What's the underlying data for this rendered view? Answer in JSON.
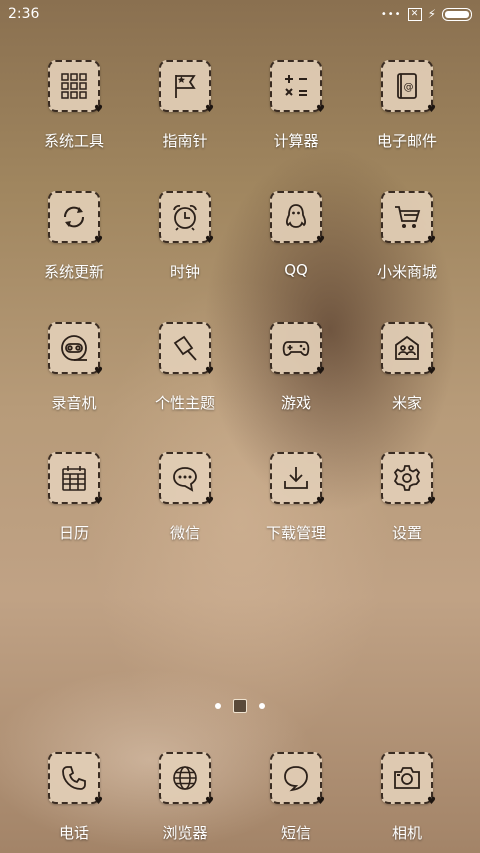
{
  "status_bar": {
    "time": "2:36"
  },
  "apps": [
    {
      "label": "系统工具",
      "icon": "folder-grid-icon",
      "slug": "system-tools"
    },
    {
      "label": "指南针",
      "icon": "compass-flag-icon",
      "slug": "compass"
    },
    {
      "label": "计算器",
      "icon": "calculator-icon",
      "slug": "calculator"
    },
    {
      "label": "电子邮件",
      "icon": "mail-icon",
      "slug": "email"
    },
    {
      "label": "系统更新",
      "icon": "refresh-icon",
      "slug": "system-update"
    },
    {
      "label": "时钟",
      "icon": "alarm-clock-icon",
      "slug": "clock"
    },
    {
      "label": "QQ",
      "icon": "qq-penguin-icon",
      "slug": "qq"
    },
    {
      "label": "小米商城",
      "icon": "shopping-cart-icon",
      "slug": "mi-store"
    },
    {
      "label": "录音机",
      "icon": "cassette-icon",
      "slug": "recorder"
    },
    {
      "label": "个性主题",
      "icon": "paint-brush-icon",
      "slug": "themes"
    },
    {
      "label": "游戏",
      "icon": "gamepad-icon",
      "slug": "games"
    },
    {
      "label": "米家",
      "icon": "home-people-icon",
      "slug": "mijia"
    },
    {
      "label": "日历",
      "icon": "calendar-icon",
      "slug": "calendar"
    },
    {
      "label": "微信",
      "icon": "chat-bubble-icon",
      "slug": "wechat"
    },
    {
      "label": "下载管理",
      "icon": "download-icon",
      "slug": "download-manager"
    },
    {
      "label": "设置",
      "icon": "gear-icon",
      "slug": "settings"
    }
  ],
  "dock": [
    {
      "label": "电话",
      "icon": "phone-icon",
      "slug": "phone"
    },
    {
      "label": "浏览器",
      "icon": "globe-icon",
      "slug": "browser"
    },
    {
      "label": "短信",
      "icon": "message-bubble-icon",
      "slug": "messages"
    },
    {
      "label": "相机",
      "icon": "camera-icon",
      "slug": "camera"
    }
  ]
}
